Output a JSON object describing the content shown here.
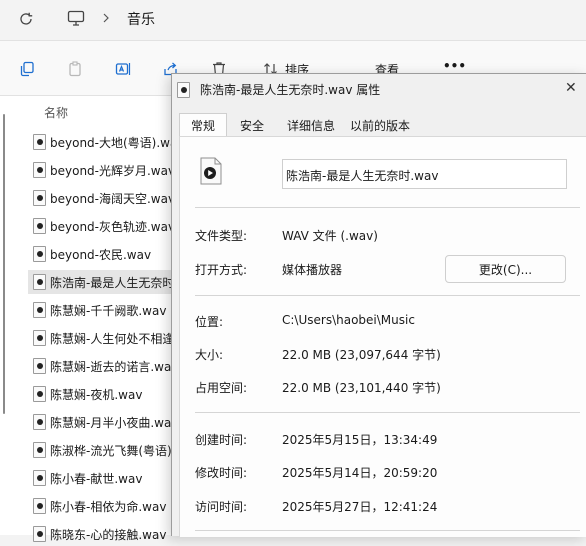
{
  "address": {
    "folder": "音乐"
  },
  "toolbar": {
    "sort_label": "排序",
    "view_label": "查看",
    "more_label": "•••"
  },
  "filelist": {
    "column_name": "名称",
    "files": [
      "beyond-大地(粤语).wav",
      "beyond-光辉岁月.wav",
      "beyond-海阔天空.wav",
      "beyond-灰色轨迹.wav",
      "beyond-农民.wav",
      "陈浩南-最是人生无奈时",
      "陈慧娴-千千阙歌.wav",
      "陈慧娴-人生何处不相逢",
      "陈慧娴-逝去的诺言.wav",
      "陈慧娴-夜机.wav",
      "陈慧娴-月半小夜曲.wav",
      "陈淑桦-流光飞舞(粤语)",
      "陈小春-献世.wav",
      "陈小春-相依为命.wav",
      "陈晓东-心的接触.wav"
    ],
    "selected_index": 5
  },
  "dialog": {
    "title": "陈浩南-最是人生无奈时.wav 属性",
    "close_glyph": "✕",
    "tabs": [
      "常规",
      "安全",
      "详细信息",
      "以前的版本"
    ],
    "active_tab": 0,
    "filename": "陈浩南-最是人生无奈时.wav",
    "type_label": "文件类型:",
    "type_value": "WAV 文件 (.wav)",
    "open_label": "打开方式:",
    "open_value": "媒体播放器",
    "change_button": "更改(C)...",
    "location_label": "位置:",
    "location_value": "C:\\Users\\haobei\\Music",
    "size_label": "大小:",
    "size_value": "22.0 MB (23,097,644 字节)",
    "disk_label": "占用空间:",
    "disk_value": "22.0 MB (23,101,440 字节)",
    "created_label": "创建时间:",
    "created_value": "2025年5月15日，13:34:49",
    "modified_label": "修改时间:",
    "modified_value": "2025年5月14日，20:59:20",
    "accessed_label": "访问时间:",
    "accessed_value": "2025年5月27日，12:41:24"
  }
}
